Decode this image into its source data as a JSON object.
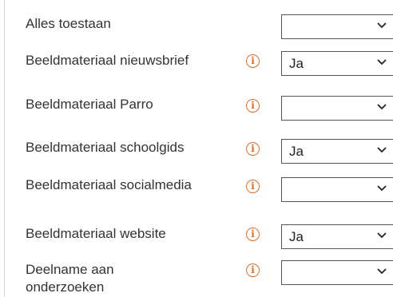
{
  "permissions": [
    {
      "label": "Alles toestaan",
      "has_info": false,
      "value": ""
    },
    {
      "label": "Beeldmateriaal nieuwsbrief",
      "has_info": true,
      "value": "Ja"
    },
    {
      "label": "Beeldmateriaal Parro",
      "has_info": true,
      "value": ""
    },
    {
      "label": "Beeldmateriaal schoolgids",
      "has_info": true,
      "value": "Ja"
    },
    {
      "label": "Beeldmateriaal socialmedia",
      "has_info": true,
      "value": ""
    },
    {
      "label": "Beeldmateriaal website",
      "has_info": true,
      "value": "Ja"
    },
    {
      "label": "Deelname aan onderzoeken",
      "has_info": true,
      "value": ""
    }
  ],
  "info_icon": {
    "name": "info-icon",
    "glyph": "i",
    "color": "#e36b1e"
  },
  "dropdown_icon": {
    "name": "chevron-down-icon"
  }
}
